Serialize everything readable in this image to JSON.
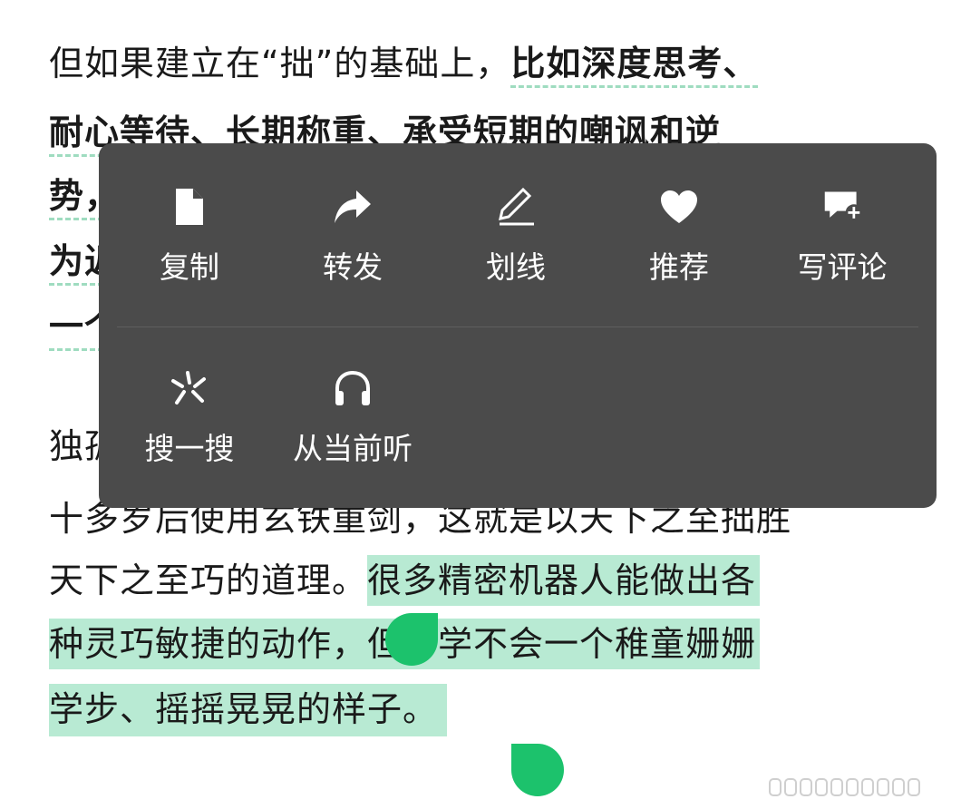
{
  "article": {
    "lines": [
      {
        "plain": "但如果建立在“拙”的基础上，",
        "bold": "比如深度思考、"
      },
      {
        "bold": "耐心等待、长期称重、承受短期的嘲讽和逆"
      },
      {
        "bold": "势，"
      },
      {
        "bold": "为近"
      },
      {
        "bold": "一个"
      },
      {
        "plain": "独孤"
      },
      {
        "plain": "十多岁后使用玄铁重剑，这就是以天下之至拙胜"
      },
      {
        "plain": "天下之至巧的道理。",
        "selected": "很多精密机器人能做出各"
      },
      {
        "selected_a": "种灵巧敏捷的动作，",
        "selected_b": "但却学不会一个稚童姗姗"
      },
      {
        "selected": "学步、摇摇晃晃的样子。"
      }
    ]
  },
  "popup": {
    "row1": [
      {
        "label": "复制",
        "icon": "document-icon"
      },
      {
        "label": "转发",
        "icon": "share-arrow-icon"
      },
      {
        "label": "划线",
        "icon": "pen-underline-icon"
      },
      {
        "label": "推荐",
        "icon": "heart-icon"
      },
      {
        "label": "写评论",
        "icon": "comment-add-icon"
      }
    ],
    "row2": [
      {
        "label": "搜一搜",
        "icon": "search-spark-icon"
      },
      {
        "label": "从当前听",
        "icon": "headphones-icon"
      }
    ]
  },
  "colors": {
    "selection": "#b8ead3",
    "handle": "#1cc26c",
    "popup_bg": "#4b4b4b",
    "underline": "#9fdcc0"
  }
}
